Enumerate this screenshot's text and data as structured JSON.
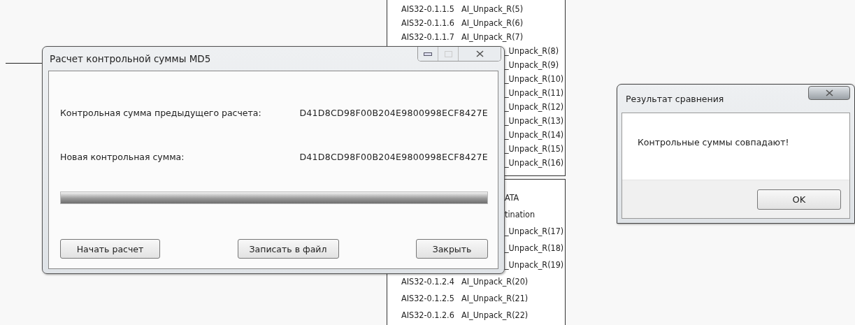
{
  "listing_top": {
    "rows": [
      {
        "kind": "full",
        "code": "AIS32-0.1.1.5",
        "signal": "AI_Unpack_R(5)"
      },
      {
        "kind": "full",
        "code": "AIS32-0.1.1.6",
        "signal": "AI_Unpack_R(6)"
      },
      {
        "kind": "full",
        "code": "AIS32-0.1.1.7",
        "signal": "AI_Unpack_R(7)"
      },
      {
        "kind": "tail",
        "signal": "_Unpack_R(8)"
      },
      {
        "kind": "tail",
        "signal": "_Unpack_R(9)"
      },
      {
        "kind": "tail",
        "signal": "_Unpack_R(10)"
      },
      {
        "kind": "tail",
        "signal": "_Unpack_R(11)"
      },
      {
        "kind": "tail",
        "signal": "_Unpack_R(12)"
      },
      {
        "kind": "tail",
        "signal": "_Unpack_R(13)"
      },
      {
        "kind": "tail",
        "signal": "_Unpack_R(14)"
      },
      {
        "kind": "tail",
        "signal": "_Unpack_R(15)"
      },
      {
        "kind": "tail",
        "signal": "_Unpack_R(16)"
      }
    ]
  },
  "listing_bottom": {
    "rows": [
      {
        "kind": "tail",
        "signal": "ATA"
      },
      {
        "kind": "tail",
        "signal": "tination"
      },
      {
        "kind": "tail",
        "signal": "_Unpack_R(17)"
      },
      {
        "kind": "tail",
        "signal": "_Unpack_R(18)"
      },
      {
        "kind": "tail",
        "signal": "_Unpack_R(19)"
      },
      {
        "kind": "full",
        "code": "AIS32-0.1.2.4",
        "signal": "AI_Unpack_R(20)"
      },
      {
        "kind": "full",
        "code": "AIS32-0.1.2.5",
        "signal": "AI_Unpack_R(21)"
      },
      {
        "kind": "full",
        "code": "AIS32-0.1.2.6",
        "signal": "AI_Unpack_R(22)"
      }
    ]
  },
  "md5_window": {
    "title": "Расчет контрольной суммы MD5",
    "fields": [
      {
        "label": "Контрольная сумма предыдущего расчета:",
        "value": "D41D8CD98F00B204E9800998ECF8427E"
      },
      {
        "label": "Новая контрольная сумма:",
        "value": "D41D8CD98F00B204E9800998ECF8427E"
      }
    ],
    "progress": {
      "level": 1
    },
    "buttons": [
      "Начать расчет",
      "Записать в файл",
      "Закрыть"
    ]
  },
  "result_window": {
    "title": "Результат сравнения",
    "message": "Контрольные суммы совпадают!",
    "buttons": [
      "OK"
    ]
  }
}
